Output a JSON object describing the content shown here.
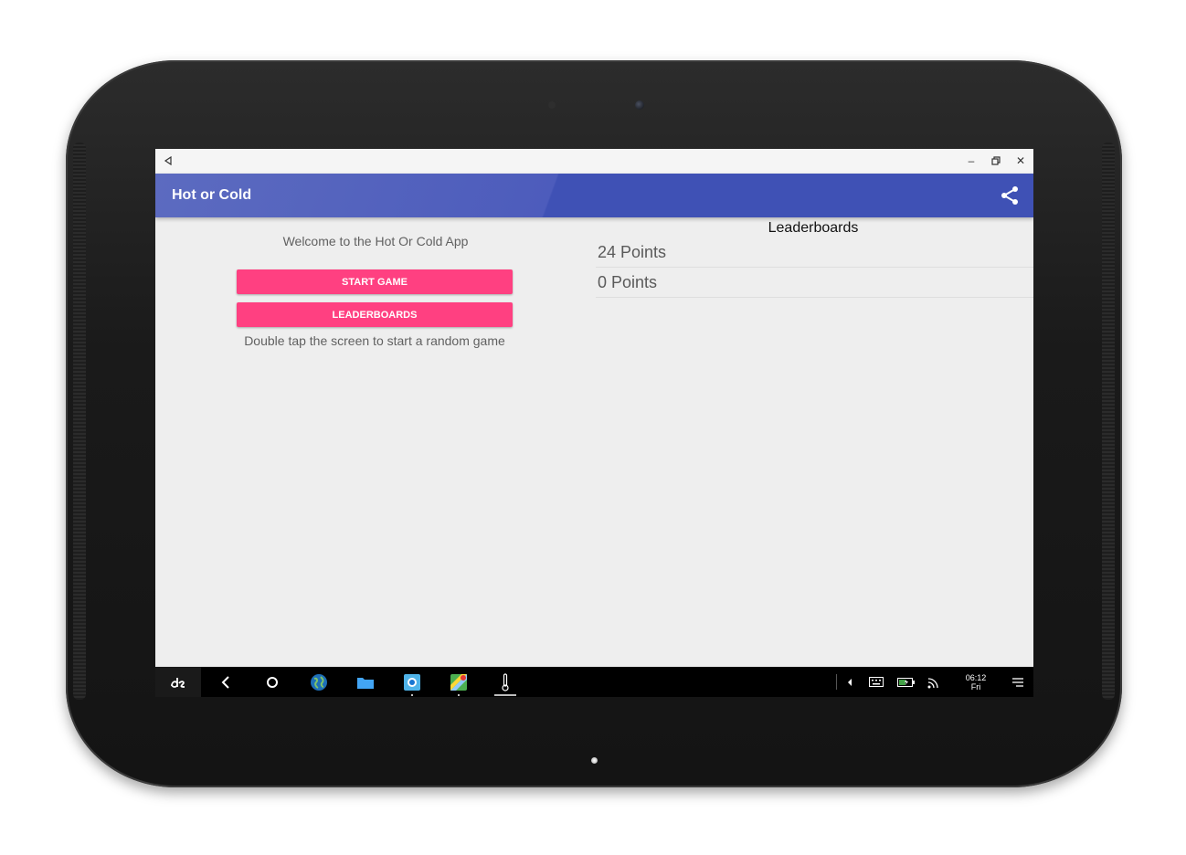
{
  "window": {
    "back_icon": "back-triangle-icon",
    "minimize_icon": "minimize-icon",
    "restore_icon": "restore-icon",
    "close_icon": "close-icon",
    "minimize_glyph": "–",
    "close_glyph": "✕"
  },
  "app_bar": {
    "title": "Hot or Cold",
    "share_icon": "share-icon",
    "color": "#3f51b5"
  },
  "main": {
    "welcome_text": "Welcome to the Hot Or Cold App",
    "start_button": "START GAME",
    "leaderboards_button": "LEADERBOARDS",
    "hint_text": "Double tap the screen to start a random game",
    "button_color": "#ff4081"
  },
  "leaderboards": {
    "title": "Leaderboards",
    "entries": [
      "24 Points",
      "0 Points"
    ]
  },
  "taskbar": {
    "items": [
      "start-menu-icon",
      "back-icon",
      "home-icon",
      "browser-icon",
      "files-icon",
      "camera-icon",
      "maps-icon",
      "thermometer-icon"
    ],
    "tray": [
      "tray-expand-icon",
      "keyboard-icon",
      "battery-icon",
      "wifi-icon",
      "notifications-icon"
    ],
    "time": "06:12",
    "day": "Fri"
  }
}
